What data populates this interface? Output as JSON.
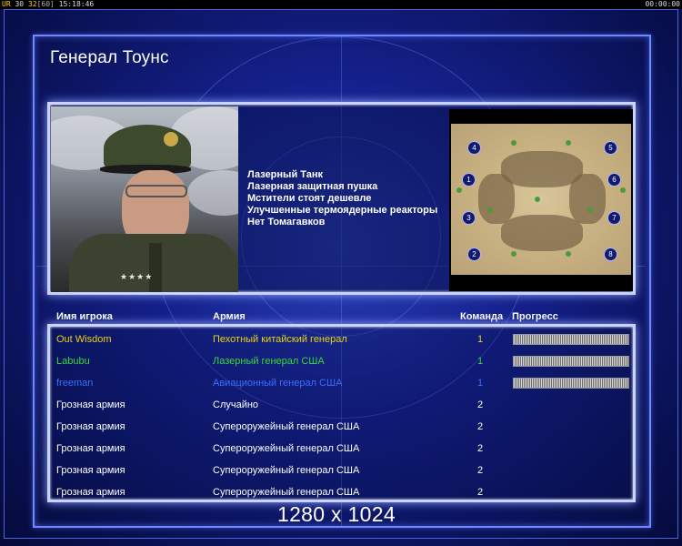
{
  "status_bar": {
    "ur_label": "UR",
    "ur_a": "30",
    "ur_b": "32",
    "ur_c": "[60]",
    "clock": "15:18:46",
    "timer": "00:00:00"
  },
  "title": "Генерал Тоунс",
  "features": [
    "Лазерный Танк",
    "Лазерная защитная пушка",
    "Мстители стоят дешевле",
    "Улучшенные термоядерные реакторы",
    "Нет Томагавков"
  ],
  "map_slots": [
    "4",
    "1",
    "3",
    "2",
    "5",
    "6",
    "7",
    "8"
  ],
  "columns": {
    "player": "Имя игрока",
    "army": "Армия",
    "team": "Команда",
    "progress": "Прогресс"
  },
  "players": [
    {
      "name": "Out Wisdom",
      "army": "Пехотный китайский генерал",
      "team": "1",
      "color": "#e8d21c",
      "progress": 1.0
    },
    {
      "name": "Labubu",
      "army": "Лазерный генерал США",
      "team": "1",
      "color": "#39d63a",
      "progress": 1.0
    },
    {
      "name": "freeman",
      "army": "Авиационный генерал США",
      "team": "1",
      "color": "#3f6cff",
      "progress": 1.0
    },
    {
      "name": "Грозная армия",
      "army": "Случайно",
      "team": "2",
      "color": "#ffffff"
    },
    {
      "name": "Грозная армия",
      "army": "Супероружейный генерал США",
      "team": "2",
      "color": "#ffffff"
    },
    {
      "name": "Грозная армия",
      "army": "Супероружейный генерал США",
      "team": "2",
      "color": "#ffffff"
    },
    {
      "name": "Грозная армия",
      "army": "Супероружейный генерал США",
      "team": "2",
      "color": "#ffffff"
    },
    {
      "name": "Грозная армия",
      "army": "Супероружейный генерал США",
      "team": "2",
      "color": "#ffffff"
    }
  ],
  "resolution_overlay": "1280 x 1024"
}
